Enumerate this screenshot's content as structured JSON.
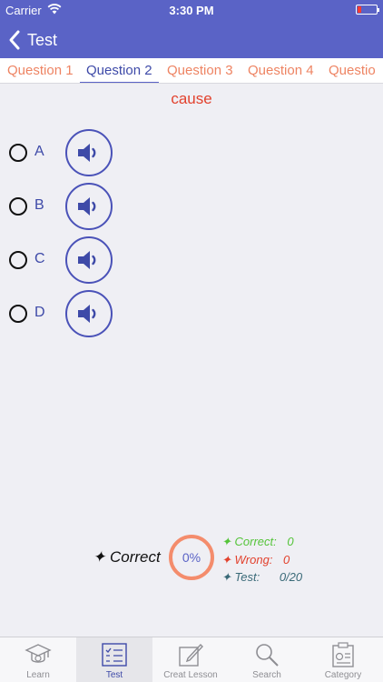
{
  "status": {
    "carrier": "Carrier",
    "time": "3:30 PM"
  },
  "nav": {
    "back_label": "Test"
  },
  "question_tabs": [
    "Question 1",
    "Question 2",
    "Question 3",
    "Question 4",
    "Questio"
  ],
  "active_tab": "Question 2",
  "word": "cause",
  "options": [
    "A",
    "B",
    "C",
    "D"
  ],
  "score": {
    "label": "✦ Correct",
    "percent": "0%",
    "correct_label": "✦ Correct:",
    "correct_value": "0",
    "wrong_label": "✦ Wrong:",
    "wrong_value": "0",
    "test_label": "✦ Test:",
    "test_value": "0/20"
  },
  "tabbar": [
    {
      "label": "Learn",
      "icon": "graduation-cap-icon"
    },
    {
      "label": "Test",
      "icon": "checklist-icon"
    },
    {
      "label": "Creat Lesson",
      "icon": "edit-icon"
    },
    {
      "label": "Search",
      "icon": "search-icon"
    },
    {
      "label": "Category",
      "icon": "clipboard-icon"
    }
  ],
  "colors": {
    "accent": "#5a63c6",
    "tab_inactive": "#ee8463",
    "word": "#e2422e"
  }
}
